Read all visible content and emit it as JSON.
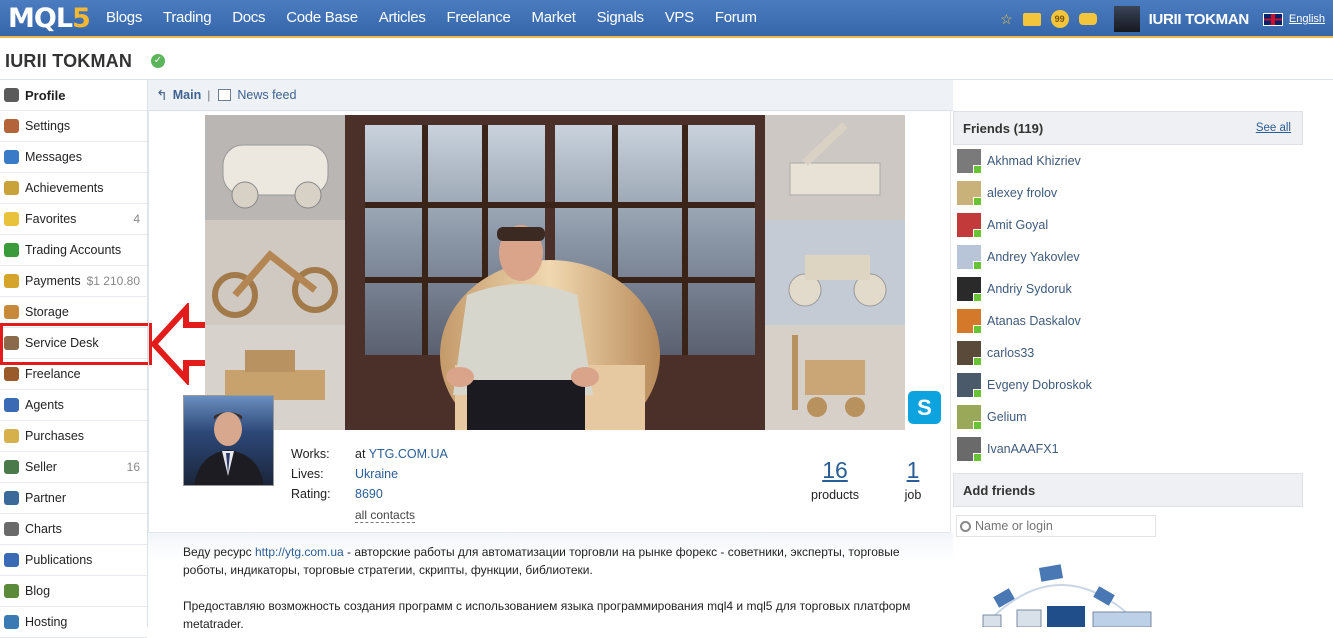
{
  "topbar": {
    "logo_main": "MQL",
    "logo_accent": "5",
    "nav": [
      "Blogs",
      "Trading",
      "Docs",
      "Code Base",
      "Articles",
      "Freelance",
      "Market",
      "Signals",
      "VPS",
      "Forum"
    ],
    "badge_count": "99",
    "username": "IURII TOKMAN",
    "language": "English"
  },
  "page": {
    "title": "IURII TOKMAN"
  },
  "sidebar": {
    "items": [
      {
        "label": "Profile",
        "count": "",
        "icon": "profile-icon",
        "color": "#5a5a5a"
      },
      {
        "label": "Settings",
        "count": "",
        "icon": "settings-icon",
        "color": "#b4643a"
      },
      {
        "label": "Messages",
        "count": "",
        "icon": "messages-icon",
        "color": "#3a7bc8"
      },
      {
        "label": "Achievements",
        "count": "",
        "icon": "achievements-icon",
        "color": "#c9a23a"
      },
      {
        "label": "Favorites",
        "count": "4",
        "icon": "star-icon",
        "color": "#e8c23a"
      },
      {
        "label": "Trading Accounts",
        "count": "",
        "icon": "trading-accounts-icon",
        "color": "#3a9b3a"
      },
      {
        "label": "Payments",
        "count": "$1 210.80",
        "icon": "payments-icon",
        "color": "#d4a52a"
      },
      {
        "label": "Storage",
        "count": "",
        "icon": "storage-icon",
        "color": "#c68a3a"
      },
      {
        "label": "Service Desk",
        "count": "",
        "icon": "service-desk-icon",
        "color": "#8a6a4a"
      },
      {
        "label": "Freelance",
        "count": "",
        "icon": "freelance-icon",
        "color": "#9a5a2a"
      },
      {
        "label": "Agents",
        "count": "",
        "icon": "agents-icon",
        "color": "#3a6ab4"
      },
      {
        "label": "Purchases",
        "count": "",
        "icon": "purchases-icon",
        "color": "#d6b04a"
      },
      {
        "label": "Seller",
        "count": "16",
        "icon": "seller-icon",
        "color": "#4a7a4a"
      },
      {
        "label": "Partner",
        "count": "",
        "icon": "partner-icon",
        "color": "#3a6a9a"
      },
      {
        "label": "Charts",
        "count": "",
        "icon": "charts-icon",
        "color": "#6a6a6a"
      },
      {
        "label": "Publications",
        "count": "",
        "icon": "publications-icon",
        "color": "#3a6ab4"
      },
      {
        "label": "Blog",
        "count": "",
        "icon": "blog-icon",
        "color": "#5a8a3a"
      },
      {
        "label": "Hosting",
        "count": "",
        "icon": "hosting-icon",
        "color": "#3a7ab4"
      }
    ]
  },
  "tabs": {
    "main": "Main",
    "separator": "|",
    "news": "News feed"
  },
  "info": {
    "works_label": "Works:",
    "works_prefix": "at",
    "works_value": "YTG.COM.UA",
    "lives_label": "Lives:",
    "lives_value": "Ukraine",
    "rating_label": "Rating:",
    "rating_value": "8690",
    "all_contacts": "all contacts"
  },
  "stats": {
    "products_count": "16",
    "products_label": "products",
    "job_count": "1",
    "job_label": "job"
  },
  "about": {
    "p1_before": "Веду ресурс",
    "p1_link": "http://ytg.com.ua",
    "p1_after": "- авторские работы для автоматизации торговли на рынке форекс - советники, эксперты, торговые роботы, индикаторы, торговые стратегии, скрипты, функции, библиотеки.",
    "p2": "Предоставляю возможность создания программ с использованием языка программирования mql4 и mql5 для торговых платформ metatrader."
  },
  "friends": {
    "title": "Friends (119)",
    "see_all": "See all",
    "list": [
      {
        "name": "Akhmad Khizriev",
        "color": "#7a7a7a"
      },
      {
        "name": "alexey frolov",
        "color": "#c9b27a"
      },
      {
        "name": "Amit Goyal",
        "color": "#c23a3a"
      },
      {
        "name": "Andrey Yakovlev",
        "color": "#b8c4d8"
      },
      {
        "name": "Andriy Sydoruk",
        "color": "#2a2a2a"
      },
      {
        "name": "Atanas Daskalov",
        "color": "#d4782a"
      },
      {
        "name": "carlos33",
        "color": "#5a4a3a"
      },
      {
        "name": "Evgeny Dobroskok",
        "color": "#4a5a6a"
      },
      {
        "name": "Gelium",
        "color": "#9aa85a"
      },
      {
        "name": "IvanAAAFX1",
        "color": "#6a6a6a"
      }
    ]
  },
  "add_friends": {
    "title": "Add friends",
    "placeholder": "Name or login"
  },
  "skype": "S"
}
